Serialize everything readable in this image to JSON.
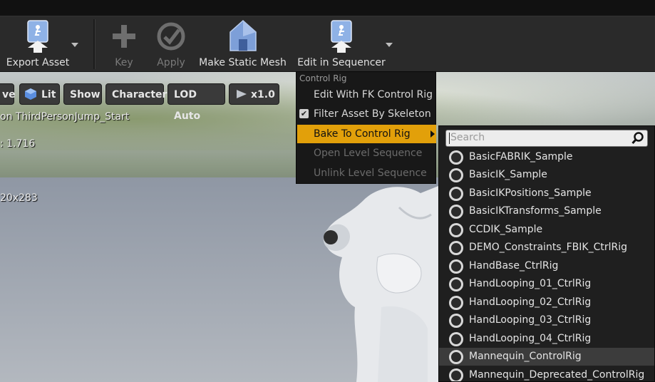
{
  "toolbar": {
    "export_asset": "Export Asset",
    "key": "Key",
    "apply": "Apply",
    "make_static_mesh": "Make Static Mesh",
    "edit_in_sequencer": "Edit in Sequencer"
  },
  "viewport": {
    "chips": {
      "partial": "ve",
      "lit": "Lit",
      "show": "Show",
      "character": "Character",
      "lod": "LOD Auto",
      "speed": "x1.0"
    },
    "overlay": {
      "animation": "on ThirdPersonJump_Start",
      "value": ": 1.716",
      "resolution": "20x283"
    }
  },
  "control_rig_menu": {
    "header": "Control Rig",
    "items": [
      {
        "label": "Edit With FK Control Rig",
        "enabled": true
      },
      {
        "label": "Filter Asset By Skeleton",
        "enabled": true,
        "checked": true
      },
      {
        "label": "Bake To Control Rig",
        "enabled": true,
        "highlighted": true,
        "submenu": true
      },
      {
        "label": "Open Level Sequence",
        "enabled": false
      },
      {
        "label": "Unlink Level Sequence",
        "enabled": false
      }
    ]
  },
  "bake_submenu": {
    "search_placeholder": "Search",
    "rigs": [
      "BasicFABRIK_Sample",
      "BasicIK_Sample",
      "BasicIKPositions_Sample",
      "BasicIKTransforms_Sample",
      "CCDIK_Sample",
      "DEMO_Constraints_FBIK_CtrlRig",
      "HandBase_CtrlRig",
      "HandLooping_01_CtrlRig",
      "HandLooping_02_CtrlRig",
      "HandLooping_03_CtrlRig",
      "HandLooping_04_CtrlRig",
      "Mannequin_ControlRig",
      "Mannequin_Deprecated_ControlRig"
    ],
    "selected": "Mannequin_ControlRig"
  },
  "colors": {
    "highlight": "#e2a00a",
    "menu_bg": "#181818",
    "toolbar_bg": "#2a2a2a"
  }
}
